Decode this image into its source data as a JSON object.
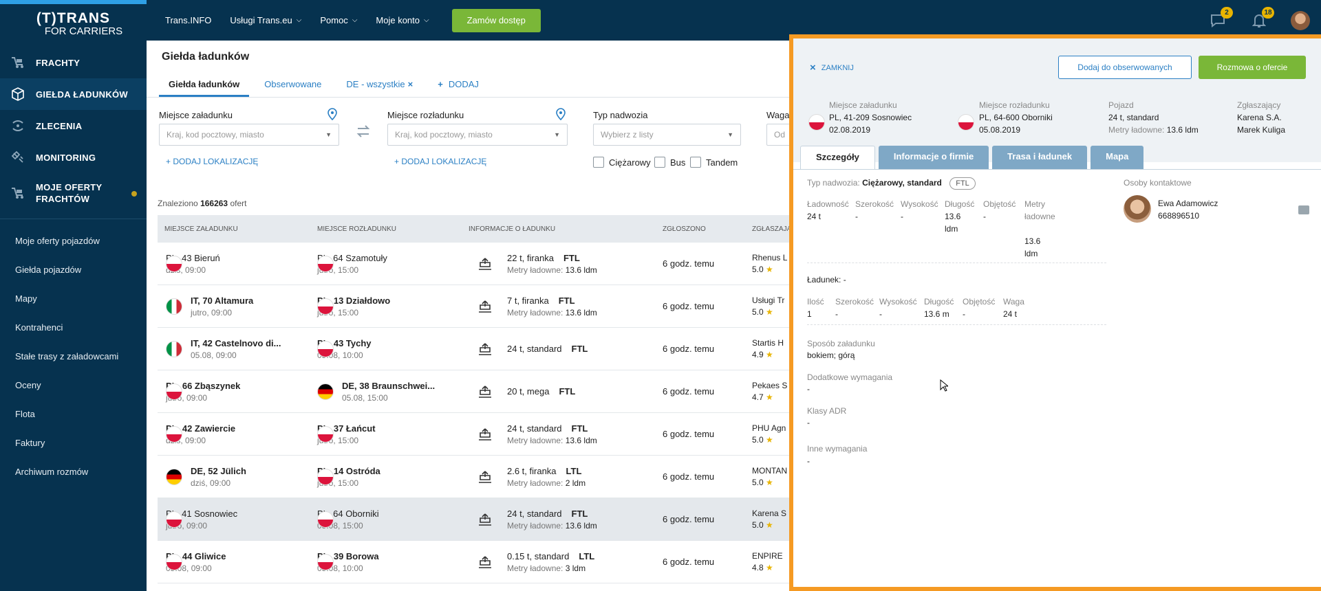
{
  "logo": {
    "line1": "(T)TRANS",
    "line2": "FOR CARRIERS"
  },
  "sidebar": {
    "main": [
      {
        "label": "FRACHTY",
        "icon": "freight-icon"
      },
      {
        "label": "GIEŁDA ŁADUNKÓW",
        "icon": "box-icon",
        "active": true
      },
      {
        "label": "ZLECENIA",
        "icon": "orders-icon"
      },
      {
        "label": "MONITORING",
        "icon": "satellite-icon"
      },
      {
        "label": "MOJE OFERTY FRACHTÓW",
        "icon": "my-offers-icon"
      }
    ],
    "sub": [
      "Moje oferty pojazdów",
      "Giełda pojazdów",
      "Mapy",
      "Kontrahenci",
      "Stałe trasy z załadowcami",
      "Oceny",
      "Flota",
      "Faktury",
      "Archiwum rozmów"
    ]
  },
  "topbar": {
    "items": [
      "Trans.INFO",
      "Usługi Trans.eu",
      "Pomoc",
      "Moje konto"
    ],
    "order_button": "Zamów dostęp",
    "messages_badge": "2",
    "notifications_badge": "18"
  },
  "page": {
    "title": "Giełda ładunków",
    "tabs": [
      "Giełda ładunków",
      "Obserwowane",
      "DE - wszystkie",
      "DODAJ"
    ],
    "tab_close": "×",
    "tab_add": "+"
  },
  "filters": {
    "loading_label": "Miejsce załadunku",
    "loading_placeholder": "Kraj, kod pocztowy, miasto",
    "unloading_label": "Miejsce rozładunku",
    "unloading_placeholder": "Kraj, kod pocztowy, miasto",
    "add_location": "+ DODAJ LOKALIZACJĘ",
    "body_label": "Typ nadwozia",
    "body_placeholder": "Wybierz z listy",
    "weight_label": "Waga",
    "weight_placeholder": "Od",
    "checkboxes": [
      "Ciężarowy",
      "Bus",
      "Tandem"
    ]
  },
  "results": {
    "found_prefix": "Znaleziono",
    "found_count": "166263",
    "found_suffix": "ofert",
    "headers": [
      "MIEJSCE ZAŁADUNKU",
      "MIEJSCE ROZŁADUNKU",
      "INFORMACJE O ŁADUNKU",
      "ZGŁOSZONO",
      "ZGŁASZAJĄCY"
    ],
    "rows": [
      {
        "from_flag": "pl",
        "from": "PL, 43 Bieruń",
        "from_time": "dziś, 09:00",
        "to_flag": "pl",
        "to": "PL, 64 Szamotuły",
        "to_time": "jutro, 15:00",
        "load": "22 t, firanka",
        "type": "FTL",
        "ldm": "13.6 ldm",
        "reported": "6 godz. temu",
        "company": "Rhenus L",
        "rating": "5.0",
        "bold": false
      },
      {
        "from_flag": "it",
        "from": "IT, 70 Altamura",
        "from_time": "jutro, 09:00",
        "to_flag": "pl",
        "to": "PL, 13 Działdowo",
        "to_time": "jutro, 15:00",
        "load": "7 t, firanka",
        "type": "FTL",
        "ldm": "13.6 ldm",
        "reported": "6 godz. temu",
        "company": "Usługi Tr",
        "rating": "5.0",
        "bold": true
      },
      {
        "from_flag": "it",
        "from": "IT, 42 Castelnovo di...",
        "from_time": "05.08, 09:00",
        "to_flag": "pl",
        "to": "PL, 43 Tychy",
        "to_time": "05.08, 10:00",
        "load": "24 t, standard",
        "type": "FTL",
        "ldm": "",
        "reported": "6 godz. temu",
        "company": "Startis H",
        "rating": "4.9",
        "bold": true
      },
      {
        "from_flag": "pl",
        "from": "PL, 66 Zbąszynek",
        "from_time": "jutro, 09:00",
        "to_flag": "de",
        "to": "DE, 38 Braunschwei...",
        "to_time": "05.08, 15:00",
        "load": "20 t, mega",
        "type": "FTL",
        "ldm": "",
        "reported": "6 godz. temu",
        "company": "Pekaes S",
        "rating": "4.7",
        "bold": true
      },
      {
        "from_flag": "pl",
        "from": "PL, 42 Zawiercie",
        "from_time": "dziś, 09:00",
        "to_flag": "pl",
        "to": "PL, 37 Łańcut",
        "to_time": "jutro, 15:00",
        "load": "24 t, standard",
        "type": "FTL",
        "ldm": "13.6 ldm",
        "reported": "6 godz. temu",
        "company": "PHU Agn",
        "rating": "5.0",
        "bold": true
      },
      {
        "from_flag": "de",
        "from": "DE, 52 Jülich",
        "from_time": "dziś, 09:00",
        "to_flag": "pl",
        "to": "PL, 14 Ostróda",
        "to_time": "jutro, 15:00",
        "load": "2.6 t, firanka",
        "type": "LTL",
        "ldm": "2 ldm",
        "reported": "6 godz. temu",
        "company": "MONTAN",
        "rating": "5.0",
        "bold": true
      },
      {
        "from_flag": "pl",
        "from": "PL, 41 Sosnowiec",
        "from_time": "jutro, 09:00",
        "to_flag": "pl",
        "to": "PL, 64 Oborniki",
        "to_time": "05.08, 15:00",
        "load": "24 t, standard",
        "type": "FTL",
        "ldm": "13.6 ldm",
        "reported": "6 godz. temu",
        "company": "Karena S",
        "rating": "5.0",
        "bold": false,
        "selected": true
      },
      {
        "from_flag": "pl",
        "from": "PL, 44 Gliwice",
        "from_time": "05.08, 09:00",
        "to_flag": "pl",
        "to": "PL, 39 Borowa",
        "to_time": "05.08, 10:00",
        "load": "0.15 t, standard",
        "type": "LTL",
        "ldm": "3 ldm",
        "reported": "6 godz. temu",
        "company": "ENPIRE",
        "rating": "4.8",
        "bold": true
      }
    ],
    "ldm_label": "Metry ładowne:",
    "star": "★"
  },
  "panel": {
    "close": "ZAMKNIJ",
    "observe_button": "Dodaj do obserwowanych",
    "talk_button": "Rozmowa o ofercie",
    "loading": {
      "title": "Miejsce załadunku",
      "place": "PL, 41-209 Sosnowiec",
      "date": "02.08.2019"
    },
    "unloading": {
      "title": "Miejsce rozładunku",
      "place": "PL, 64-600 Oborniki",
      "date": "05.08.2019"
    },
    "vehicle": {
      "title": "Pojazd",
      "value": "24 t, standard",
      "ldm_label": "Metry ładowne:",
      "ldm": "13.6 ldm"
    },
    "reporter": {
      "title": "Zgłaszający",
      "company": "Karena S.A.",
      "person": "Marek Kuliga"
    },
    "tabs": [
      "Szczegóły",
      "Informacje o firmie",
      "Trasa i ładunek",
      "Mapa"
    ],
    "details": {
      "body_label": "Typ nadwozia:",
      "body_value": "Ciężarowy, standard",
      "body_badge": "FTL",
      "capacity_headers": [
        "Ładowność",
        "Szerokość",
        "Wysokość",
        "Długość",
        "Objętość",
        "Metry ładowne"
      ],
      "capacity_values": [
        "24 t",
        "-",
        "-",
        "13.6 ldm",
        "-",
        "13.6 ldm"
      ],
      "cargo_label": "Ładunek: -",
      "cargo_headers": [
        "Ilość",
        "Szerokość",
        "Wysokość",
        "Długość",
        "Objętość",
        "Waga"
      ],
      "cargo_values": [
        "1",
        "-",
        "-",
        "13.6 m",
        "-",
        "24 t"
      ],
      "loading_method_label": "Sposób załadunku",
      "loading_method_value": "bokiem; górą",
      "extra_label": "Dodatkowe wymagania",
      "extra_value": "-",
      "adr_label": "Klasy ADR",
      "adr_value": "-",
      "other_label": "Inne wymagania",
      "other_value": "-"
    },
    "contacts": {
      "title": "Osoby kontaktowe",
      "name": "Ewa Adamowicz",
      "phone": "668896510"
    }
  },
  "colors": {
    "sidebar": "#06324f",
    "accent": "#2a7fc4",
    "green": "#7ab738",
    "panel_border": "#f59a23",
    "badge": "#e8b400"
  }
}
